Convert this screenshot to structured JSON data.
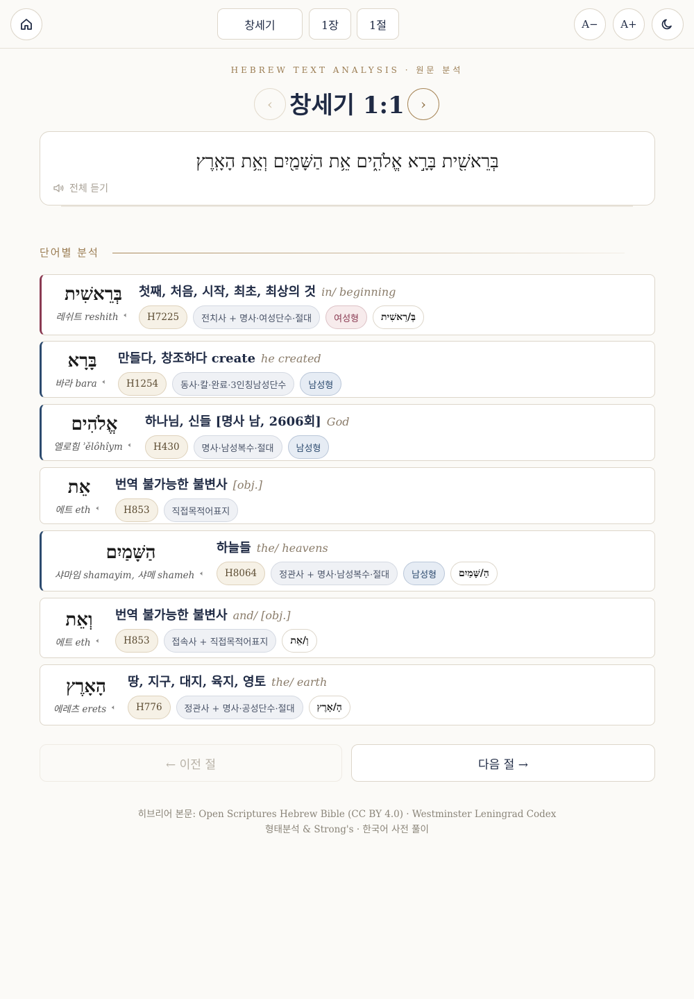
{
  "topbar": {
    "book": "창세기",
    "chapter": "1장",
    "verse": "1절",
    "font_decrease": "A−",
    "font_increase": "A+"
  },
  "header": {
    "kicker": "HEBREW TEXT ANALYSIS · 원문 분석",
    "title": "창세기 1:1",
    "prev_arrow": "‹",
    "next_arrow": "›"
  },
  "verse": {
    "hebrew": "בְּרֵאשִׁ֖ית בָּרָ֣א אֱלֹהִ֑ים אֵ֥ת הַשָּׁמַ֖יִם וְאֵ֥ת הָאָֽרֶץ",
    "listen_all": "전체 듣기"
  },
  "section": {
    "label": "단어별 분석"
  },
  "words": [
    {
      "hebrew": "בְּרֵאשִׁית",
      "translit": "레쉬트 reshith",
      "gloss": "첫째, 처음, 시작, 최초, 최상의 것",
      "gloss_en": "in/ beginning",
      "strong": "H7225",
      "morph": "전치사 + 명사·여성단수·절대",
      "gender": "여성형",
      "segment": "בְּ/רֵאשִׁית"
    },
    {
      "hebrew": "בָּרָא",
      "translit": "바라 bara",
      "gloss": "만들다, 창조하다 create",
      "gloss_en": "he created",
      "strong": "H1254",
      "morph": "동사·칼·완료·3인칭남성단수",
      "gender": "남성형",
      "segment": ""
    },
    {
      "hebrew": "אֱלֹהִים",
      "translit": "엘로힘 ʾělôhîym",
      "gloss": "하나님, 신들 [명사 남, 2606회]",
      "gloss_en": "God",
      "strong": "H430",
      "morph": "명사·남성복수·절대",
      "gender": "남성형",
      "segment": ""
    },
    {
      "hebrew": "אֵת",
      "translit": "에트 eth",
      "gloss": "번역 불가능한 불변사",
      "gloss_en": "[obj.]",
      "strong": "H853",
      "morph": "직접목적어표지",
      "gender": "",
      "segment": ""
    },
    {
      "hebrew": "הַשָּׁמַיִם",
      "translit": "샤마임 shamayim, 샤메 shameh",
      "gloss": "하늘들",
      "gloss_en": "the/ heavens",
      "strong": "H8064",
      "morph": "정관사 + 명사·남성복수·절대",
      "gender": "남성형",
      "segment": "הַ/שָּׁמַיִם"
    },
    {
      "hebrew": "וְאֵת",
      "translit": "에트 eth",
      "gloss": "번역 불가능한 불변사",
      "gloss_en": "and/ [obj.]",
      "strong": "H853",
      "morph": "접속사 + 직접목적어표지",
      "gender": "",
      "segment": "וְ/אֵת"
    },
    {
      "hebrew": "הָאָרֶץ",
      "translit": "에레츠 erets",
      "gloss": "땅, 지구, 대지, 육지, 영토",
      "gloss_en": "the/ earth",
      "strong": "H776",
      "morph": "정관사 + 명사·공성단수·절대",
      "gender": "",
      "segment": "הָ/אָרֶץ"
    }
  ],
  "bottom_nav": {
    "prev": "← 이전 절",
    "next": "다음 절 →"
  },
  "footer": {
    "line1": "히브리어 본문: Open Scriptures Hebrew Bible (CC BY 4.0) · Westminster Leningrad Codex",
    "line2": "형태분석 & Strong's · 한국어 사전 풀이"
  },
  "colors": {
    "accent_gold": "#a88759",
    "feminine": "#8a3a52",
    "masculine": "#2c4a6e",
    "text_navy": "#1f2a44"
  },
  "icons": [
    "home-icon",
    "moon-icon",
    "speaker-icon"
  ]
}
